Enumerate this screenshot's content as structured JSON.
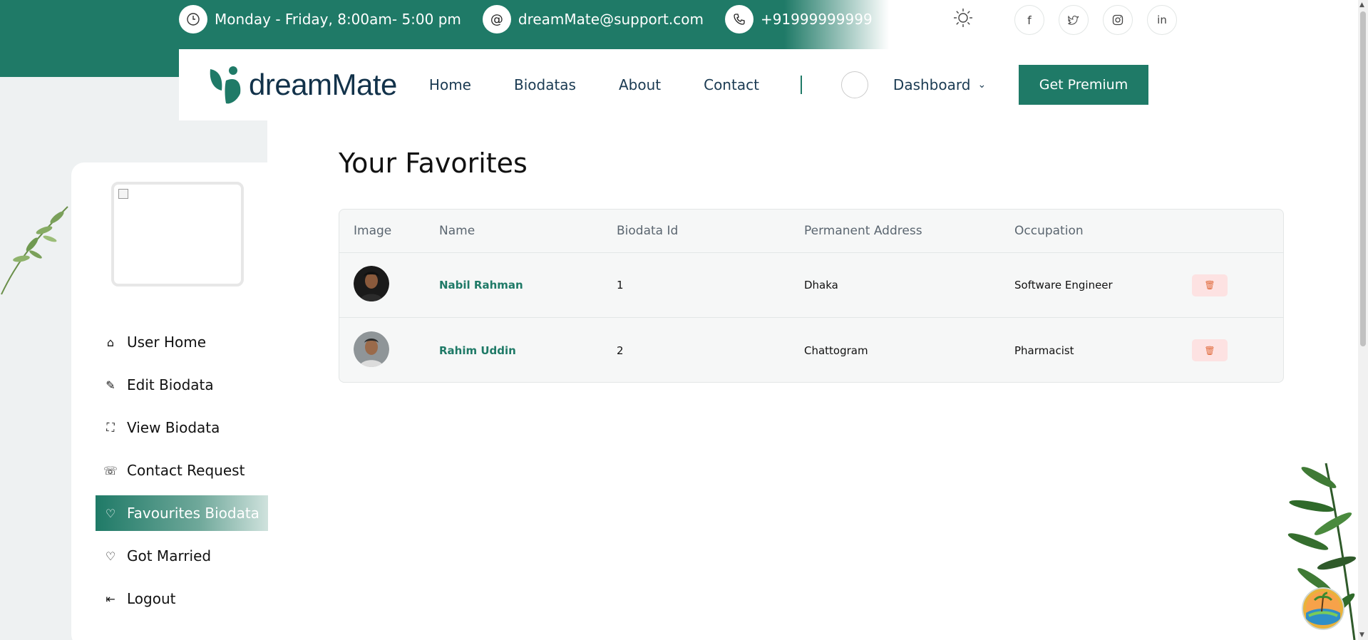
{
  "topbar": {
    "hours": "Monday - Friday, 8:00am- 5:00 pm",
    "email": "dreamMate@support.com",
    "phone": "+91999999999"
  },
  "icons": {
    "clock": "clock-icon",
    "email": "at-icon",
    "phone": "phone-icon",
    "theme": "sun-icon",
    "social": [
      "facebook-icon",
      "twitter-icon",
      "instagram-icon",
      "linkedin-icon"
    ]
  },
  "brand": {
    "name": "dreamMate"
  },
  "nav": {
    "links": [
      "Home",
      "Biodatas",
      "About",
      "Contact"
    ],
    "dashboard": "Dashboard",
    "premium": "Get Premium"
  },
  "sidebar": {
    "items": [
      {
        "label": "User Home",
        "icon": "house-icon"
      },
      {
        "label": "Edit Biodata",
        "icon": "pencil-icon"
      },
      {
        "label": "View Biodata",
        "icon": "scan-icon"
      },
      {
        "label": "Contact Request",
        "icon": "phone-call-icon"
      },
      {
        "label": "Favourites Biodata",
        "icon": "heart-icon"
      },
      {
        "label": "Got Married",
        "icon": "hearts-icon"
      },
      {
        "label": "Logout",
        "icon": "logout-icon"
      }
    ],
    "active_index": 4
  },
  "main": {
    "title": "Your Favorites",
    "columns": [
      "Image",
      "Name",
      "Biodata Id",
      "Permanent Address",
      "Occupation"
    ],
    "rows": [
      {
        "name": "Nabil Rahman",
        "id": "1",
        "address": "Dhaka",
        "occupation": "Software Engineer"
      },
      {
        "name": "Rahim Uddin",
        "id": "2",
        "address": "Chattogram",
        "occupation": "Pharmacist"
      }
    ]
  },
  "colors": {
    "brand_green": "#1f7a67",
    "delete_bg": "#fde2e2",
    "delete_icon": "#e06a3b",
    "panel_bg": "#eef1f2"
  }
}
